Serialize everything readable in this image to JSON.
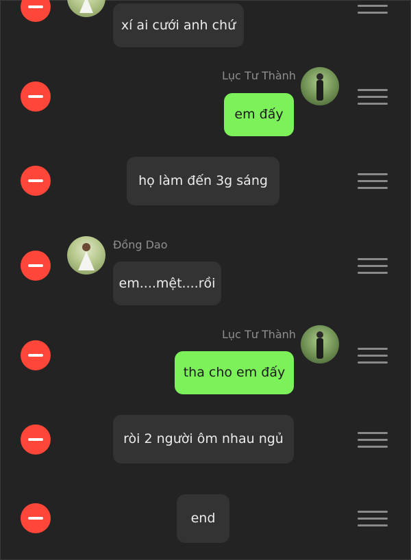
{
  "messages": [
    {
      "text": "xí ai cưới anh chứ"
    },
    {
      "sender": "Lục Tư Thành",
      "text": "em đấy"
    },
    {
      "text": "họ làm đến 3g sáng"
    },
    {
      "sender": "Đồng Dao",
      "text": "em....mệt....rồi"
    },
    {
      "sender": "Lục Tư Thành",
      "text": "tha cho em đấy"
    },
    {
      "text": "ròi 2 người ôm nhau ngủ"
    },
    {
      "text": "end"
    }
  ],
  "colors": {
    "background": "#232323",
    "delete": "#ff4638",
    "bubble_dark": "#333333",
    "bubble_green": "#7cf15a",
    "name_gray": "#8f8f8f"
  },
  "icons": {
    "delete": "minus-circle-icon",
    "drag": "drag-handle-icon"
  }
}
